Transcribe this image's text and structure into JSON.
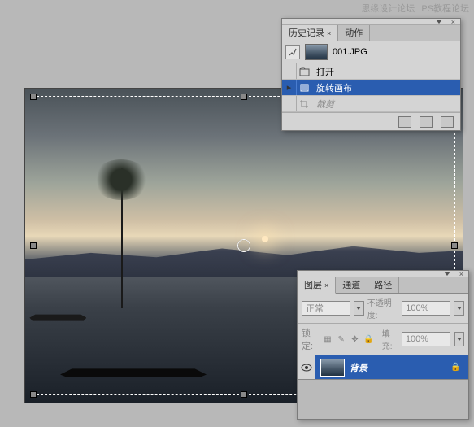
{
  "watermark": {
    "left": "思缘设计论坛",
    "right": "PS教程论坛"
  },
  "history": {
    "tabs": {
      "history": "历史记录",
      "actions": "动作"
    },
    "source_file": "001.JPG",
    "items": [
      {
        "icon": "open",
        "label": "打开"
      },
      {
        "icon": "rotate",
        "label": "旋转画布"
      },
      {
        "icon": "crop",
        "label": "裁剪"
      }
    ]
  },
  "layers": {
    "tabs": {
      "layers": "图层",
      "channels": "通道",
      "paths": "路径"
    },
    "blend_mode": "正常",
    "opacity": {
      "label": "不透明度:",
      "value": "100%"
    },
    "lock": {
      "label": "锁定:"
    },
    "fill": {
      "label": "填充:",
      "value": "100%"
    },
    "layer_name": "背景"
  }
}
